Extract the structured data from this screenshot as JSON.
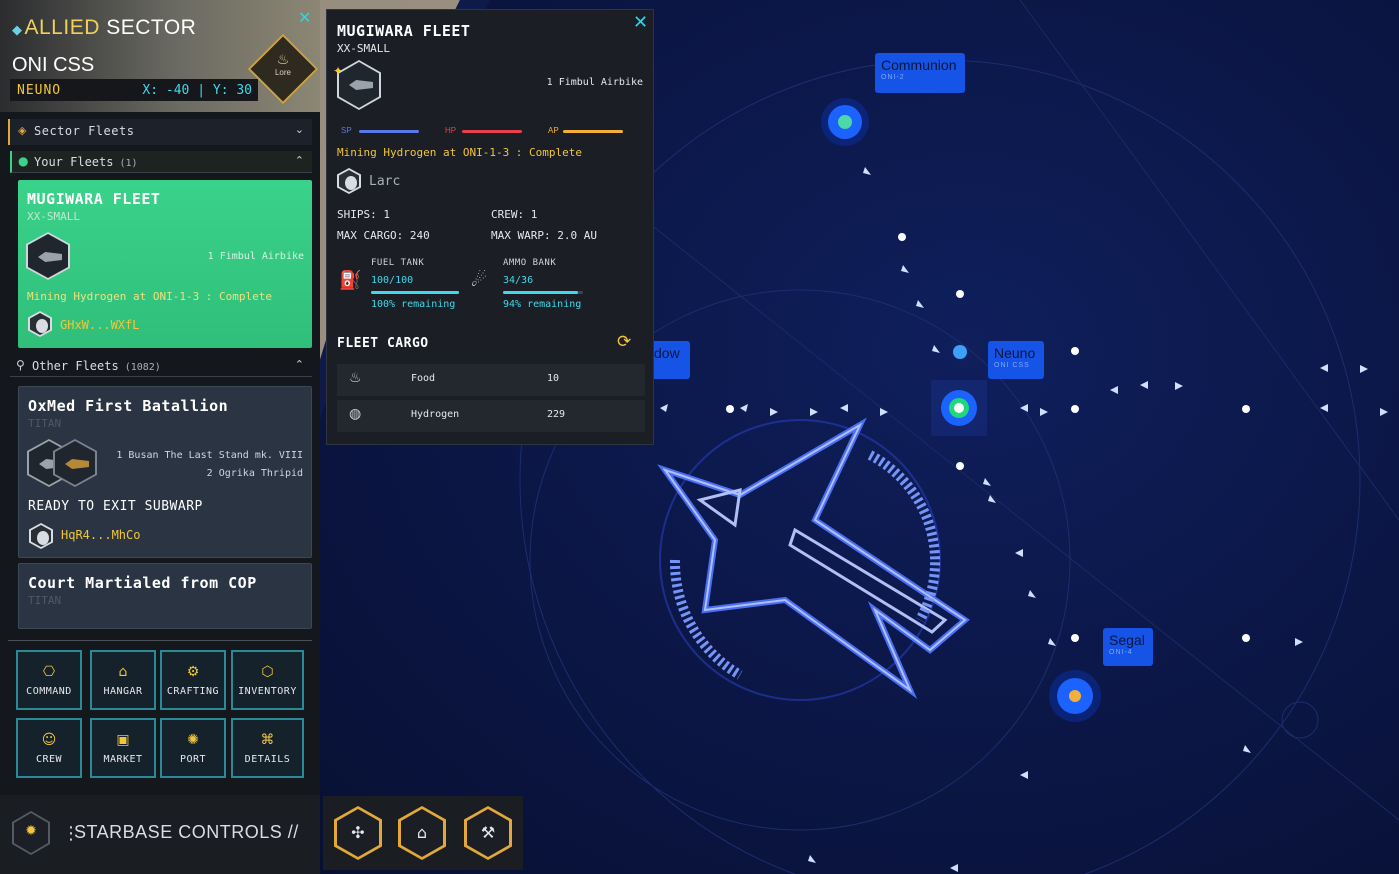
{
  "sector": {
    "title_accent": "ALLIED",
    "title_rest": " SECTOR",
    "system_name": "ONI CSS",
    "planet": "NEUNO",
    "coords": "X: -40 | Y: 30",
    "lore_label": "Lore",
    "close_icon": "close-icon"
  },
  "sections": {
    "sector_fleets": "Sector Fleets",
    "your_fleets": "Your Fleets",
    "your_fleets_count": "(1)",
    "other_fleets": "Other Fleets",
    "other_fleets_count": "(1082)"
  },
  "your_fleet": {
    "name": "MUGIWARA FLEET",
    "class": "XX-SMALL",
    "ships": "1 Fimbul Airbike",
    "status": "Mining Hydrogen at ONI-1-3 : Complete",
    "owner": "GHxW...WXfL"
  },
  "other_fleets": [
    {
      "name": "OxMed First Batallion",
      "class": "TITAN",
      "ships": [
        "1 Busan The Last Stand mk. VIII",
        "2 Ogrika Thripid"
      ],
      "state": "READY TO EXIT SUBWARP",
      "owner": "HqR4...MhCo"
    },
    {
      "name": "Court Martialed from COP",
      "class": "TITAN"
    }
  ],
  "nav": [
    {
      "label": "COMMAND",
      "icon": "command-icon"
    },
    {
      "label": "HANGAR",
      "icon": "hangar-icon"
    },
    {
      "label": "CRAFTING",
      "icon": "crafting-icon"
    },
    {
      "label": "INVENTORY",
      "icon": "inventory-icon"
    },
    {
      "label": "CREW",
      "icon": "crew-icon"
    },
    {
      "label": "MARKET",
      "icon": "market-icon"
    },
    {
      "label": "PORT",
      "icon": "port-icon"
    },
    {
      "label": "DETAILS",
      "icon": "details-icon"
    }
  ],
  "starbase": {
    "label": "STARBASE CONTROLS //"
  },
  "popup": {
    "name": "MUGIWARA FLEET",
    "class": "XX-SMALL",
    "ships": "1 Fimbul Airbike",
    "bars": [
      {
        "label": "SP",
        "color": "#5a78e6",
        "fill": 1.0
      },
      {
        "label": "HP",
        "color": "#e6404e",
        "fill": 1.0
      },
      {
        "label": "AP",
        "color": "#f2b03b",
        "fill": 1.0
      }
    ],
    "status": "Mining Hydrogen at ONI-1-3 : Complete",
    "captain": "Larc",
    "ships_count": "SHIPS: 1",
    "crew": "CREW: 1",
    "max_cargo": "MAX CARGO: 240",
    "max_warp": "MAX WARP: 2.0 AU",
    "fuel": {
      "label": "FUEL TANK",
      "value": "100/100",
      "remaining": "100% remaining",
      "fill": 1.0
    },
    "ammo": {
      "label": "AMMO BANK",
      "value": "34/36",
      "remaining": "94% remaining",
      "fill": 0.94
    },
    "cargo_title": "FLEET CARGO",
    "cargo": [
      {
        "name": "Food",
        "qty": "10",
        "icon": "food-icon"
      },
      {
        "name": "Hydrogen",
        "qty": "229",
        "icon": "hydrogen-icon"
      }
    ]
  },
  "map": {
    "systems": [
      {
        "name": "Communion",
        "sub": "ONI-2"
      },
      {
        "name": "Neuno",
        "sub": "ONI CSS"
      },
      {
        "name": "Segal",
        "sub": "ONI-4"
      },
      {
        "name": "dow",
        "sub": ""
      }
    ]
  },
  "actions": [
    {
      "icon": "subwarp-icon"
    },
    {
      "icon": "dock-icon"
    },
    {
      "icon": "mining-icon"
    }
  ]
}
